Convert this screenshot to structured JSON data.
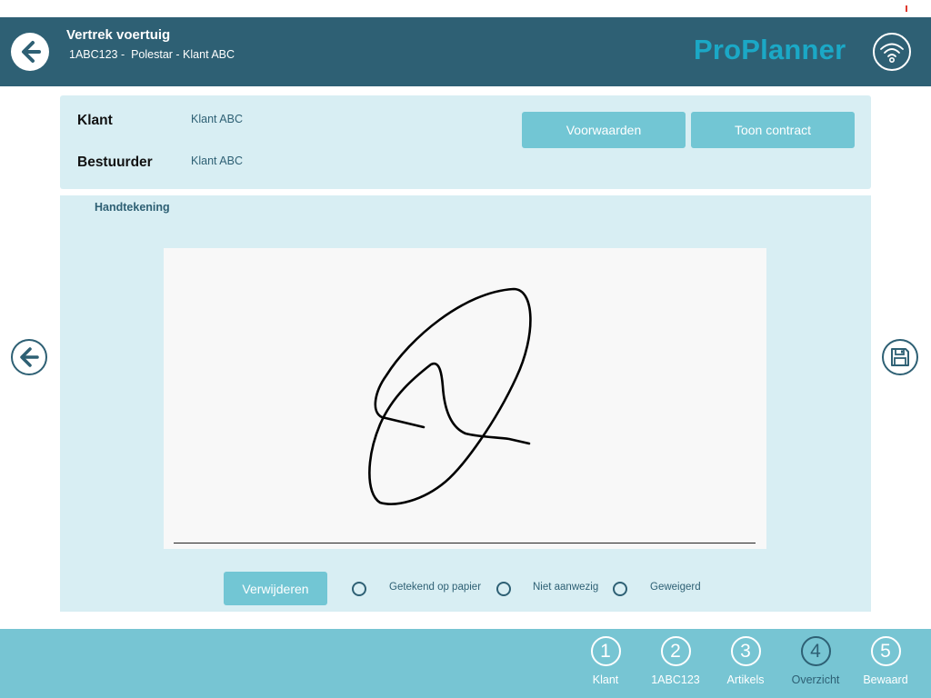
{
  "header": {
    "title": "Vertrek voertuig",
    "subtitle": "1ABC123 -  Polestar - Klant ABC",
    "logo_text": "ProPlanner",
    "back_icon": "arrow-left-icon",
    "connection_icon": "wifi-icon"
  },
  "info": {
    "customer_label": "Klant",
    "customer_value": "Klant ABC",
    "driver_label": "Bestuurder",
    "driver_value": "Klant ABC",
    "terms_button": "Voorwaarden",
    "contract_button": "Toon contract"
  },
  "signature": {
    "title": "Handtekening",
    "delete_button": "Verwijderen",
    "options": [
      {
        "label": "Getekend op papier",
        "selected": false
      },
      {
        "label": "Niet aanwezig",
        "selected": false
      },
      {
        "label": "Geweigerd",
        "selected": false
      }
    ]
  },
  "nav": {
    "prev_icon": "arrow-left-icon",
    "save_icon": "floppy-disk-icon"
  },
  "steps": [
    {
      "number": "1",
      "label": "Klant",
      "active": false
    },
    {
      "number": "2",
      "label": "1ABC123",
      "active": false
    },
    {
      "number": "3",
      "label": "Artikels",
      "active": false
    },
    {
      "number": "4",
      "label": "Overzicht",
      "active": true
    },
    {
      "number": "5",
      "label": "Bewaard",
      "active": false
    }
  ],
  "colors": {
    "header_bg": "#2e6074",
    "accent": "#1ba8c6",
    "button": "#72c6d4",
    "panel": "#d8eef3",
    "footer_bg": "#77c5d3"
  }
}
